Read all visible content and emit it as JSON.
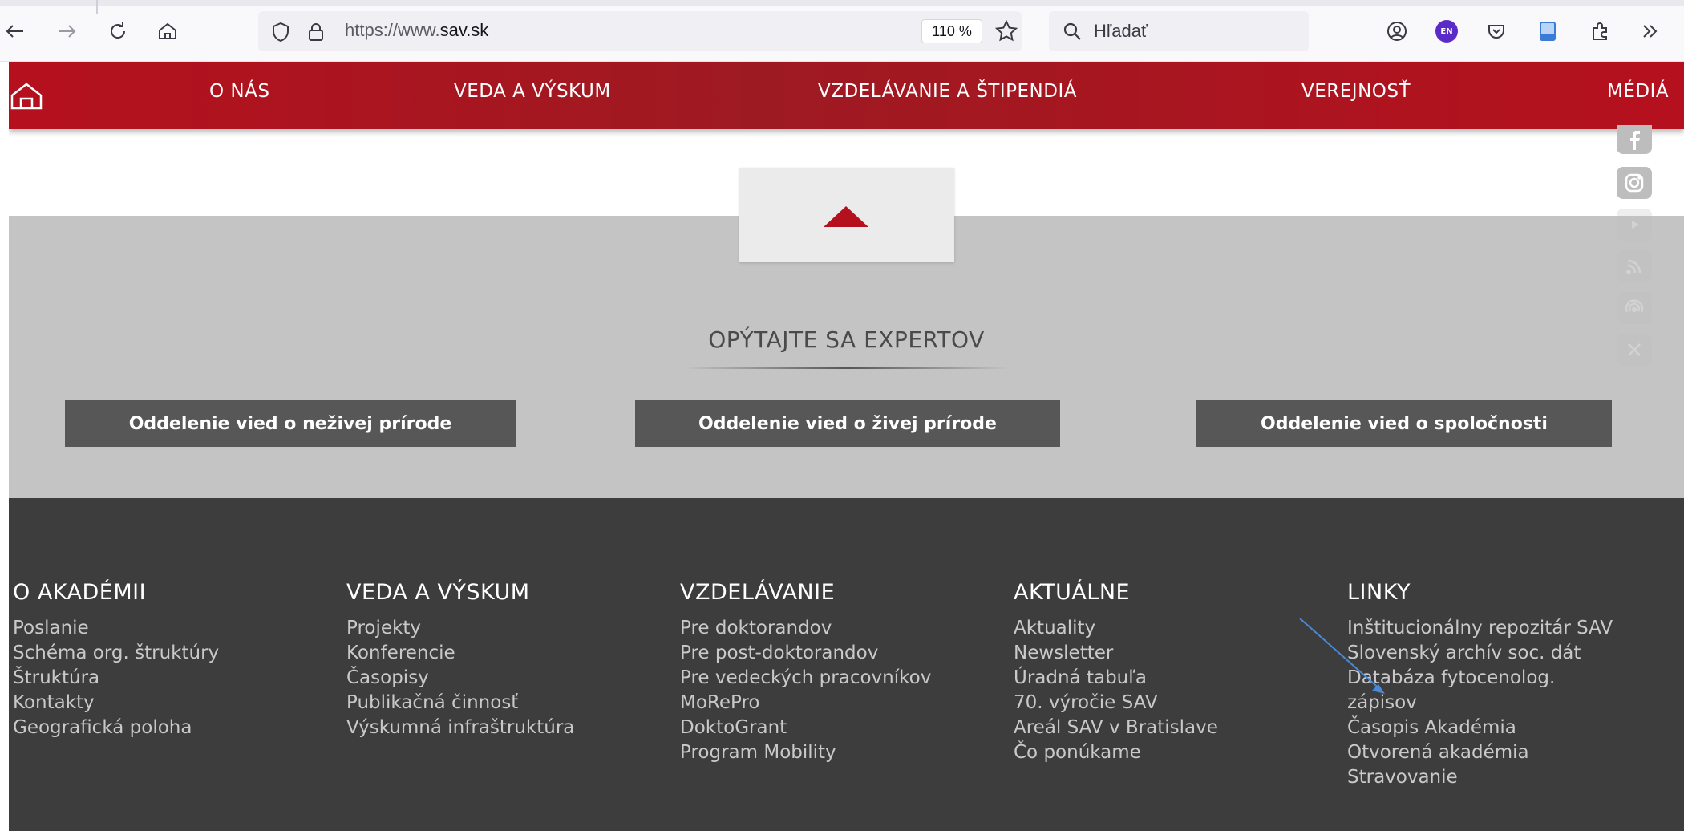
{
  "browser": {
    "url_prefix": "https://www.",
    "url_domain": "sav.sk",
    "zoom": "110 %",
    "search_placeholder": "Hľadať",
    "extension_badge": "EN"
  },
  "nav": {
    "items": [
      "O NÁS",
      "VEDA A VÝSKUM",
      "VZDELÁVANIE A ŠTIPENDIÁ",
      "VEREJNOSŤ",
      "MÉDIÁ"
    ]
  },
  "experts": {
    "title": "OPÝTAJTE SA EXPERTOV",
    "buttons": [
      "Oddelenie vied o neživej prírode",
      "Oddelenie vied o živej prírode",
      "Oddelenie vied o spoločnosti"
    ]
  },
  "footer": {
    "columns": [
      {
        "heading": "O AKADÉMII",
        "links": [
          "Poslanie",
          "Schéma org. štruktúry",
          "Štruktúra",
          "Kontakty",
          "Geografická poloha"
        ]
      },
      {
        "heading": "VEDA A VÝSKUM",
        "links": [
          "Projekty",
          "Konferencie",
          "Časopisy",
          "Publikačná činnosť",
          "Výskumná infraštruktúra"
        ]
      },
      {
        "heading": "VZDELÁVANIE",
        "links": [
          "Pre doktorandov",
          "Pre post-doktorandov",
          "Pre vedeckých pracovníkov",
          "MoRePro",
          "DoktoGrant",
          "Program Mobility"
        ]
      },
      {
        "heading": "AKTUÁLNE",
        "links": [
          "Aktuality",
          "Newsletter",
          "Úradná tabuľa",
          "70. výročie SAV",
          "Areál SAV v Bratislave",
          "Čo ponúkame"
        ]
      },
      {
        "heading": "LINKY",
        "links": [
          "Inštitucionálny repozitár SAV",
          "Slovenský archív soc. dát",
          "Databáza fytocenolog.",
          "zápisov",
          "Časopis Akadémia",
          "Otvorená akadémia",
          "Stravovanie"
        ]
      }
    ]
  },
  "colors": {
    "brand_red": "#b5101d",
    "footer_bg": "#3d3d3d",
    "section_gray": "#c4c4c4",
    "button_gray": "#575757",
    "annotation_arrow": "#4a88d9"
  }
}
